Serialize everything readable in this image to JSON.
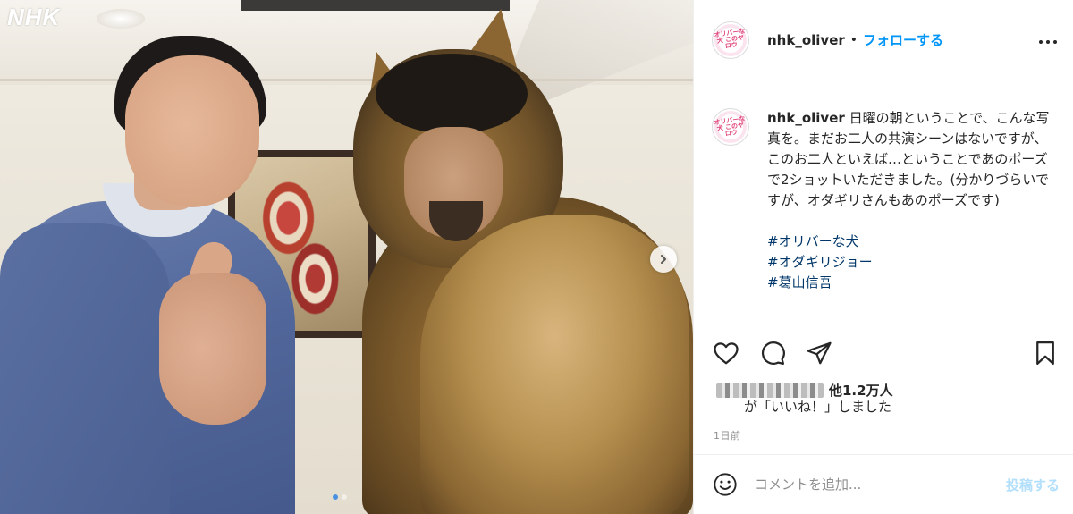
{
  "photo": {
    "watermark": "NHK",
    "carousel_dots": 2,
    "active_dot": 0
  },
  "header": {
    "username": "nhk_oliver",
    "separator": "•",
    "follow_label": "フォローする",
    "more_icon": "more-options-icon",
    "avatar_text": "オリバーな犬 このヤロウ"
  },
  "caption": {
    "username": "nhk_oliver",
    "text": "日曜の朝ということで、こんな写真を。まだお二人の共演シーンはないですが、このお二人といえば…ということであのポーズで2ショットいただきました。(分かりづらいですが、オダギリさんもあのポーズです)",
    "hashtags": [
      "#オリバーな犬",
      "#オダギリジョー",
      "#葛山信吾"
    ]
  },
  "actions": {
    "like_icon": "heart-icon",
    "comment_icon": "comment-icon",
    "share_icon": "paper-plane-icon",
    "save_icon": "bookmark-icon"
  },
  "likes": {
    "count_text": "他1.2万人",
    "liked_text": "が「いいね！」しました"
  },
  "time_ago": "1日前",
  "comment": {
    "placeholder": "コメントを追加...",
    "post_label": "投稿する",
    "emoji_icon": "smiley-icon"
  },
  "colors": {
    "link_blue": "#0095f6",
    "hashtag": "#00376b",
    "post_disabled": "#b2dffc",
    "muted": "#8e8e8e"
  }
}
